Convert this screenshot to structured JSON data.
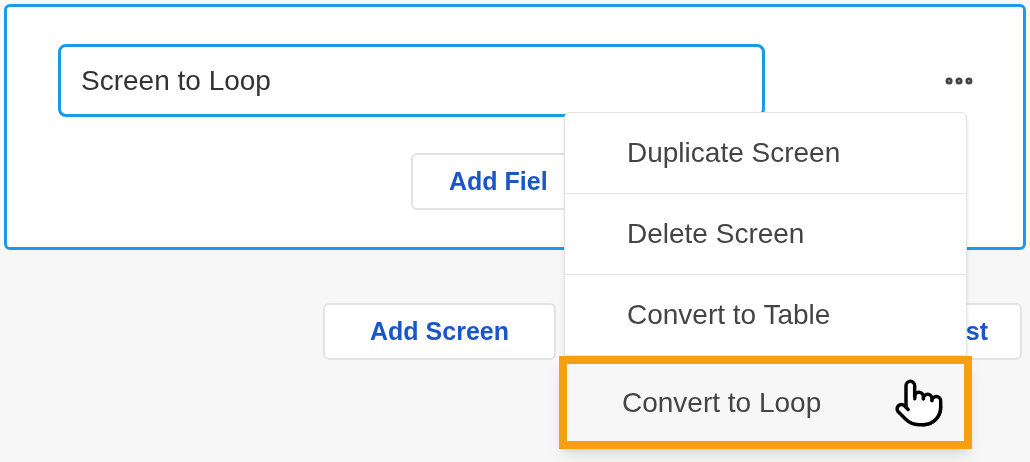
{
  "screen_card": {
    "name_field": {
      "value": "Screen to Loop"
    },
    "add_field_button": "Add Fiel"
  },
  "buttons": [
    "Add Screen",
    "st"
  ],
  "menu": {
    "items": [
      {
        "label": "Duplicate Screen",
        "selected": false
      },
      {
        "label": "Delete Screen",
        "selected": false
      },
      {
        "label": "Convert to Table",
        "selected": false
      },
      {
        "label": "Convert to Loop",
        "selected": true
      }
    ]
  }
}
